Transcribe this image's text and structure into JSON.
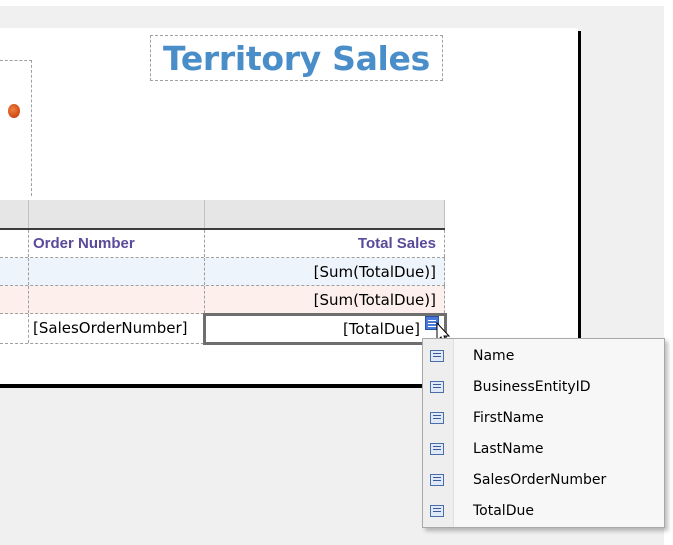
{
  "report": {
    "title": "Territory Sales"
  },
  "table": {
    "headers": [
      "",
      "Order Number",
      "Total Sales"
    ],
    "group1_total": "[Sum(TotalDue)]",
    "group2_total": "[Sum(TotalDue)]",
    "detail_order_number": "[SalesOrderNumber]",
    "detail_total_due": "[TotalDue]"
  },
  "field_menu": {
    "items": [
      {
        "label": "Name",
        "icon": "field-icon"
      },
      {
        "label": "BusinessEntityID",
        "icon": "field-icon"
      },
      {
        "label": "FirstName",
        "icon": "field-icon"
      },
      {
        "label": "LastName",
        "icon": "field-icon"
      },
      {
        "label": "SalesOrderNumber",
        "icon": "field-icon"
      },
      {
        "label": "TotalDue",
        "icon": "field-icon"
      }
    ]
  },
  "colors": {
    "title": "#4a8ec9",
    "header_text": "#5a4a9a",
    "group1_bg": "#eef4fc",
    "group2_bg": "#fdf0ec"
  }
}
